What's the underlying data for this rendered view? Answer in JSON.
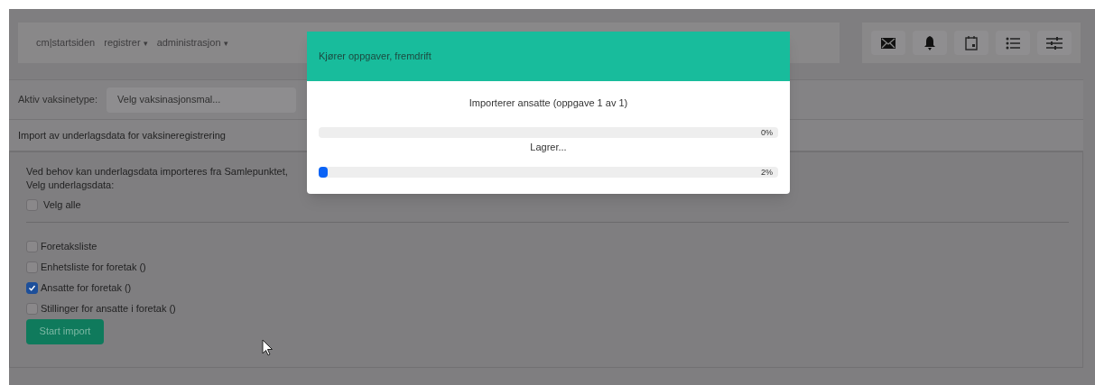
{
  "navbar": {
    "brand": "cm|startsiden",
    "menus": [
      {
        "label": "registrer",
        "caret": "▾"
      },
      {
        "label": "administrasjon",
        "caret": "▾"
      }
    ]
  },
  "toolbar": [
    {
      "kind": "mail"
    },
    {
      "kind": "bell"
    },
    {
      "kind": "calendar"
    },
    {
      "kind": "list"
    },
    {
      "kind": "sliders"
    }
  ],
  "vaccine_type": {
    "label": "Aktiv vaksinetype:",
    "placeholder": "Velg vaksinasjonsmal..."
  },
  "panel": {
    "heading": "Import av underlagsdata for vaksineregistrering",
    "intro": "Ved behov kan underlagsdata importeres fra Samlepunktet,",
    "prompt": "Velg underlagsdata:",
    "select_all": {
      "label": "Velg alle",
      "checked": false
    },
    "options": [
      {
        "label": "Foretaksliste",
        "checked": false
      },
      {
        "label": "Enhetsliste for foretak ()",
        "checked": false
      },
      {
        "label": "Ansatte for foretak ()",
        "checked": true
      },
      {
        "label": "Stillinger for ansatte i foretak ()",
        "checked": false
      }
    ],
    "button": "Start import"
  },
  "modal": {
    "title": "Kjører oppgaver, fremdrift",
    "task": "Importerer ansatte (oppgave 1 av 1)",
    "progress": [
      {
        "level": 0,
        "reading": "0%",
        "caption": "Lagrer..."
      },
      {
        "level": 0.02,
        "reading": "2%"
      }
    ]
  }
}
